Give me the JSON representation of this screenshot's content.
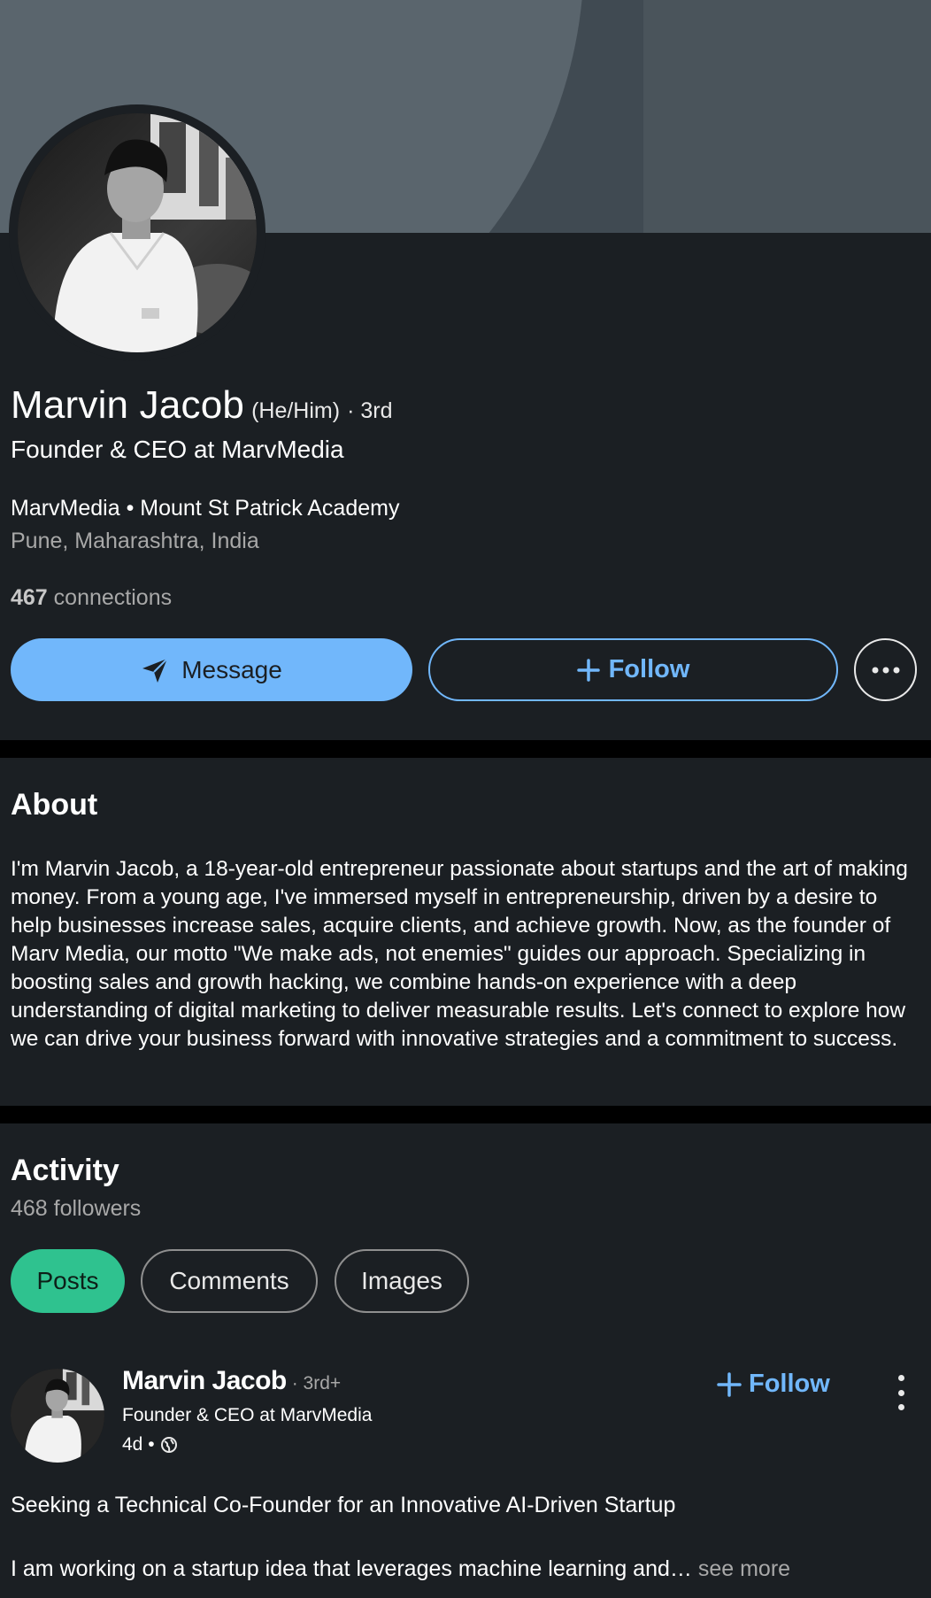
{
  "profile": {
    "name": "Marvin Jacob",
    "pronouns": "(He/Him)",
    "degree": "· 3rd",
    "headline": "Founder & CEO at MarvMedia",
    "org_line": "MarvMedia • Mount St Patrick Academy",
    "location": "Pune, Maharashtra, India",
    "connections_count": "467",
    "connections_label": "connections"
  },
  "actions": {
    "message_label": "Message",
    "follow_label": "Follow",
    "more_icon": "ellipsis-icon"
  },
  "about": {
    "title": "About",
    "text": "I'm Marvin Jacob, a 18-year-old entrepreneur passionate about startups and the art of making money. From a young age, I've immersed myself in entrepreneurship, driven by a desire to help businesses increase sales, acquire clients, and achieve growth. Now, as the founder of Marv Media, our motto \"We make ads, not enemies\" guides our approach. Specializing in boosting sales and growth hacking, we combine hands-on experience with a deep understanding of digital marketing to deliver measurable results. Let's connect to explore how we can drive your business forward with innovative strategies and a commitment to success."
  },
  "activity": {
    "title": "Activity",
    "followers": "468 followers",
    "tabs": [
      {
        "label": "Posts",
        "active": true
      },
      {
        "label": "Comments",
        "active": false
      },
      {
        "label": "Images",
        "active": false
      }
    ]
  },
  "post": {
    "author": "Marvin Jacob",
    "degree": "· 3rd+",
    "headline": "Founder & CEO at MarvMedia",
    "time": "4d •",
    "follow_label": "Follow",
    "title": "Seeking a Technical Co-Founder for an Innovative AI-Driven Startup",
    "body": "I am working on a startup idea that leverages machine learning and…",
    "see_more": " see more"
  },
  "colors": {
    "background": "#1b1f23",
    "accent_blue": "#71b7fb",
    "active_tab": "#2fc28f",
    "muted_text": "#a8a8a8"
  }
}
